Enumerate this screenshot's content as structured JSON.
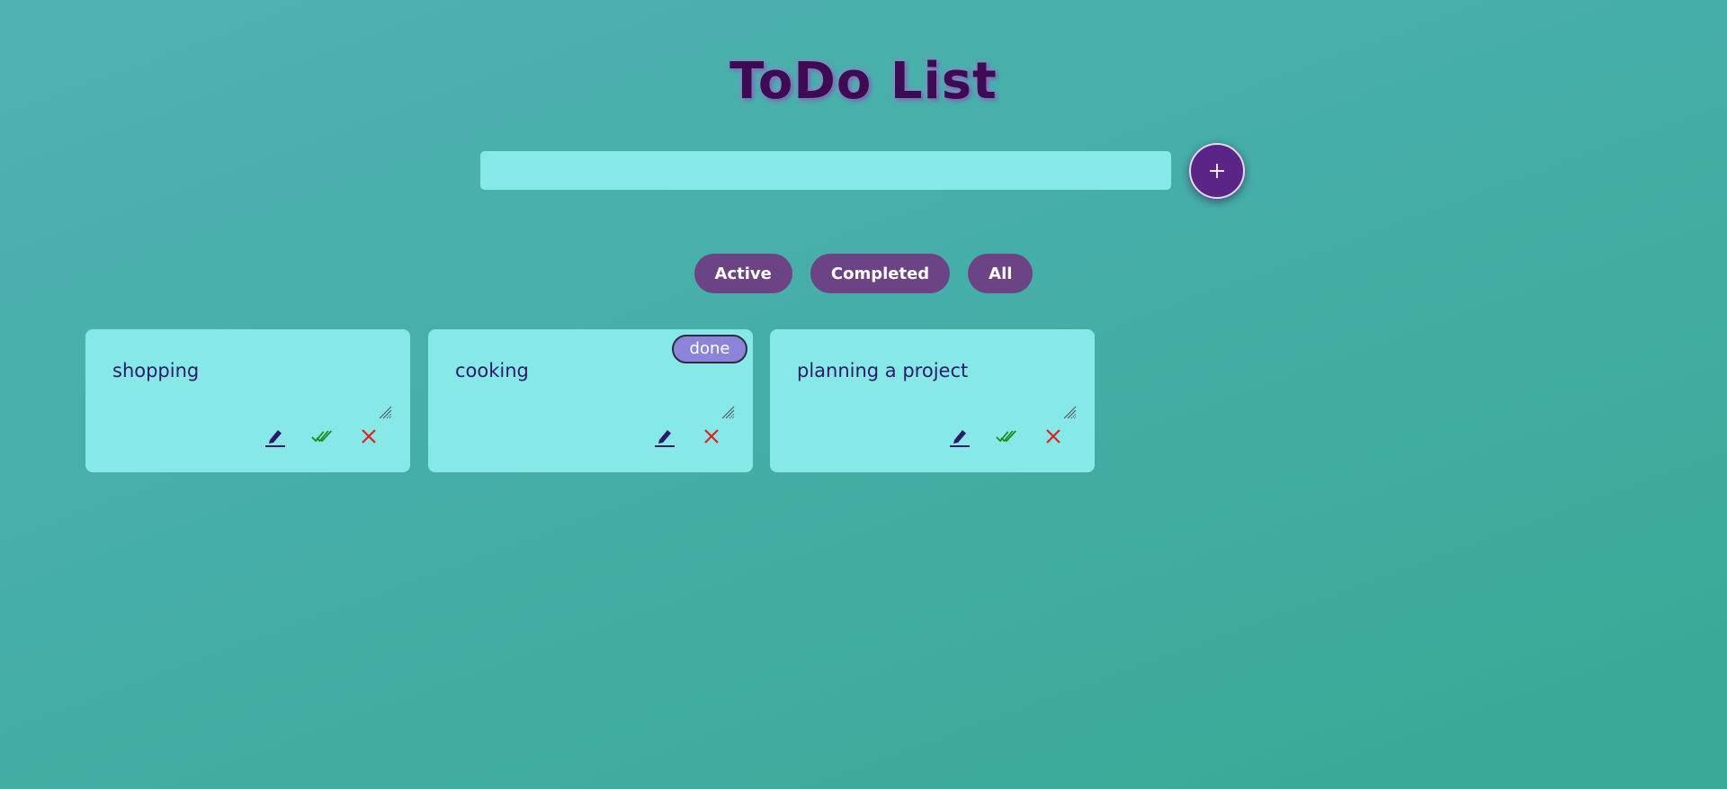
{
  "app": {
    "title": "ToDo List"
  },
  "input": {
    "value": "",
    "placeholder": ""
  },
  "add_button": {
    "icon": "plus-icon"
  },
  "filters": [
    {
      "label": "Active"
    },
    {
      "label": "Completed"
    },
    {
      "label": "All"
    }
  ],
  "tasks": [
    {
      "text": "shopping",
      "done": false
    },
    {
      "text": "cooking",
      "done": true,
      "badge": "done"
    },
    {
      "text": "planning a project",
      "done": false
    }
  ],
  "icons": {
    "edit": "pencil-icon",
    "complete": "double-check-icon",
    "delete": "close-icon",
    "resize": "resize-handle-icon"
  },
  "colors": {
    "background": "#46aea8",
    "title": "#3d0b53",
    "card": "#87e9e7",
    "filter_button": "#6c4486",
    "add_button": "#5a2586",
    "edit_icon": "#2a1a6a",
    "check_icon": "#1a8a1a",
    "delete_icon": "#e02020",
    "done_badge": "#8b84d8"
  }
}
